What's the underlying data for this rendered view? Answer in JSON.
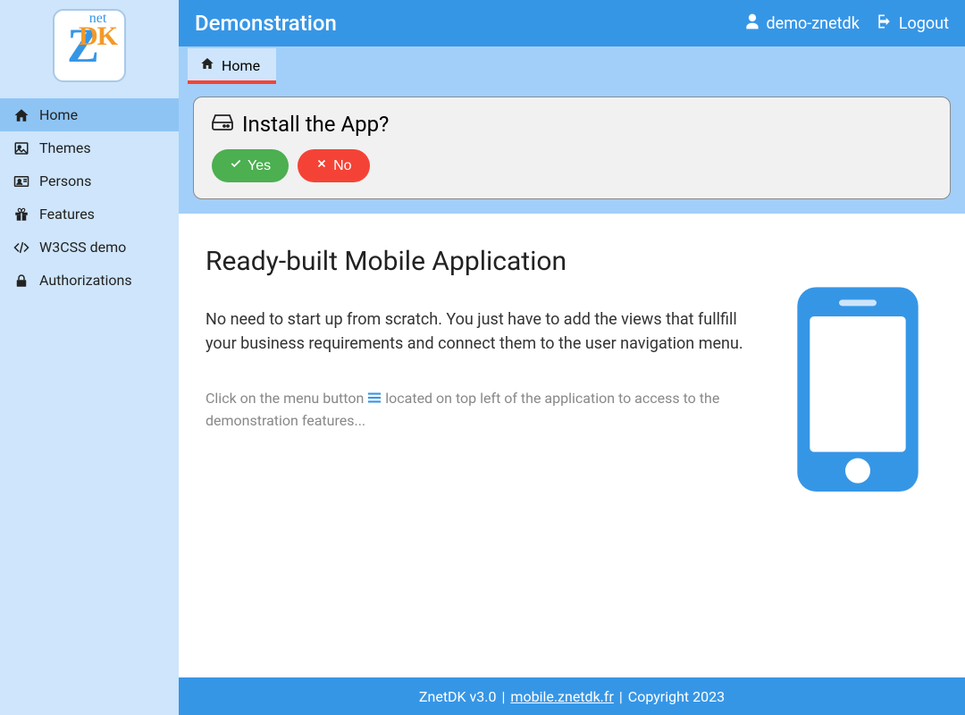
{
  "app_title": "Demonstration",
  "user": {
    "name": "demo-znetdk",
    "logout_label": "Logout"
  },
  "sidebar": {
    "items": [
      {
        "label": "Home",
        "icon": "home",
        "active": true
      },
      {
        "label": "Themes",
        "icon": "picture",
        "active": false
      },
      {
        "label": "Persons",
        "icon": "idcard",
        "active": false
      },
      {
        "label": "Features",
        "icon": "gift",
        "active": false
      },
      {
        "label": "W3CSS demo",
        "icon": "code",
        "active": false
      },
      {
        "label": "Authorizations",
        "icon": "lock",
        "active": false
      }
    ]
  },
  "tabs": [
    {
      "label": "Home",
      "icon": "home",
      "active": true
    }
  ],
  "install": {
    "title": "Install the App?",
    "yes": "Yes",
    "no": "No"
  },
  "content": {
    "heading": "Ready-built Mobile Application",
    "paragraph": "No need to start up from scratch. You just have to add the views that fullfill your business requirements and connect them to the user navigation menu.",
    "hint_before": "Click on the menu button ",
    "hint_after": " located on top left of the application to access to the demonstration features..."
  },
  "footer": {
    "product": "ZnetDK v3.0",
    "link_text": "mobile.znetdk.fr",
    "copyright": "Copyright 2023"
  }
}
